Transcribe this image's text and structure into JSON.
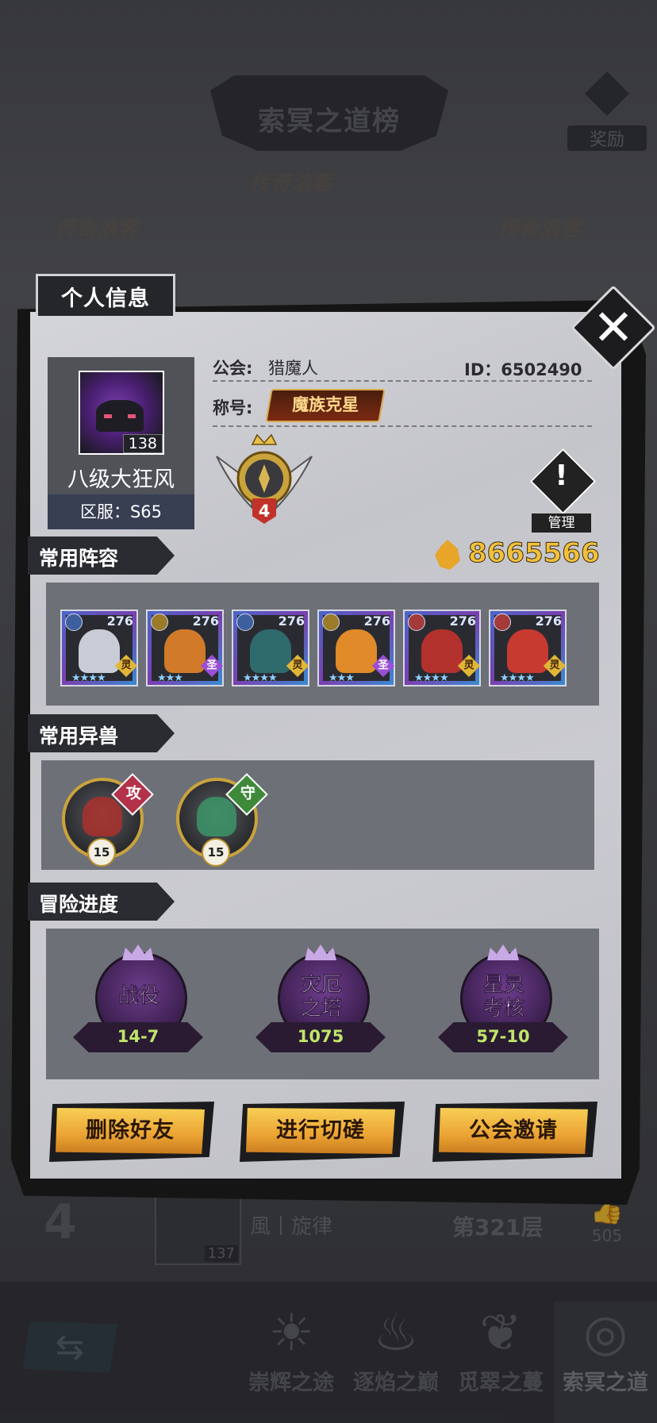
{
  "background": {
    "board_title": "索冥之道榜",
    "reward_label": "奖励",
    "logo_text": "传奇浪客",
    "row": {
      "rank": "4",
      "avatar_level": "137",
      "name": "風丨旋律",
      "floor": "第321层",
      "likes": "505"
    },
    "nav": [
      {
        "label": "崇辉之途",
        "icon": "sun-icon"
      },
      {
        "label": "逐焰之巅",
        "icon": "flame-icon"
      },
      {
        "label": "觅翠之蔓",
        "icon": "leaf-icon"
      },
      {
        "label": "索冥之道",
        "icon": "swirl-icon"
      }
    ]
  },
  "dialog": {
    "tab_title": "个人信息",
    "player": {
      "name": "八级大狂风",
      "level": "138",
      "server": "区服：S65"
    },
    "guild_label": "公会:",
    "guild_name": "猎魔人",
    "id_text": "ID：6502490",
    "title_label": "称号:",
    "title_badge": "魔族克星",
    "rank_level": "4",
    "manage_label": "管理",
    "gold": "8665566",
    "sections": {
      "lineup": "常用阵容",
      "beasts": "常用异兽",
      "progress": "冒险进度"
    },
    "heroes": [
      {
        "level": "276",
        "class": "灵",
        "stars": "★★★★",
        "el_color": "#3d5f9e",
        "body": "#c8ccd6",
        "cls_style": "gold"
      },
      {
        "level": "276",
        "class": "圣",
        "stars": "★★★",
        "el_color": "#9b7a2a",
        "body": "#d17a2a",
        "cls_style": "purple"
      },
      {
        "level": "276",
        "class": "灵",
        "stars": "★★★★",
        "el_color": "#3d5f9e",
        "body": "#2f6a6c",
        "cls_style": "gold"
      },
      {
        "level": "276",
        "class": "圣",
        "stars": "★★★",
        "el_color": "#9b7a2a",
        "body": "#e08a2a",
        "cls_style": "purple"
      },
      {
        "level": "276",
        "class": "灵",
        "stars": "★★★★",
        "el_color": "#a33b3b",
        "body": "#b3312c",
        "cls_style": "gold"
      },
      {
        "level": "276",
        "class": "灵",
        "stars": "★★★★",
        "el_color": "#a33b3b",
        "body": "#c73a30",
        "cls_style": "gold"
      }
    ],
    "beasts": [
      {
        "tag": "攻",
        "level": "15",
        "tag_color": "#b3324a",
        "body": "#b0302a"
      },
      {
        "tag": "守",
        "level": "15",
        "tag_color": "#3f8a3a",
        "body": "#3a9a6a"
      }
    ],
    "progress": [
      {
        "name": "战役",
        "value": "14-7"
      },
      {
        "name": "灾厄\n之塔",
        "value": "1075"
      },
      {
        "name": "星灵\n考核",
        "value": "57-10"
      }
    ],
    "buttons": {
      "delete": "删除好友",
      "spar": "进行切磋",
      "invite": "公会邀请"
    }
  }
}
